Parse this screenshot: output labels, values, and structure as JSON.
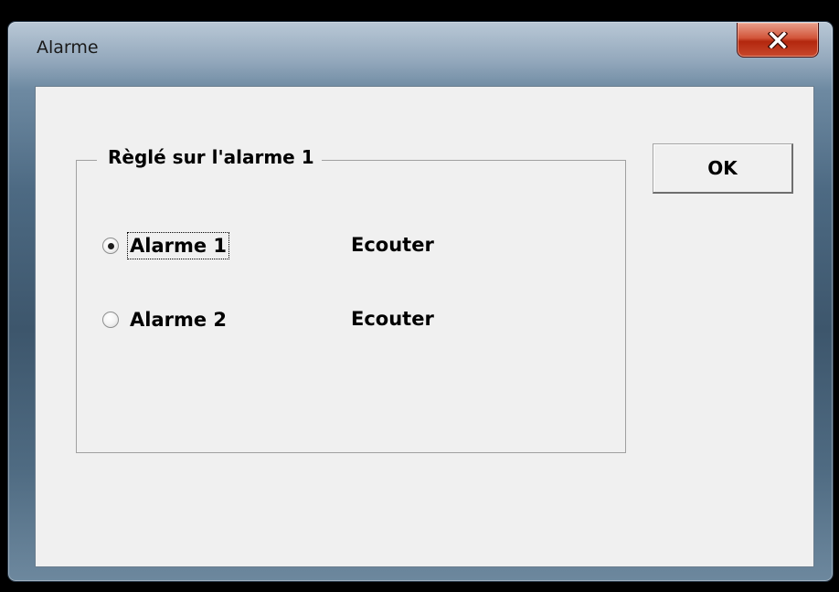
{
  "window": {
    "title": "Alarme"
  },
  "titlebar": {
    "close_icon": "close-icon"
  },
  "group": {
    "legend": "Règlé sur l'alarme 1",
    "options": [
      {
        "label": "Alarme 1",
        "selected": true,
        "focused": true,
        "listen_label": "Ecouter"
      },
      {
        "label": "Alarme 2",
        "selected": false,
        "focused": false,
        "listen_label": "Ecouter"
      }
    ]
  },
  "buttons": {
    "ok_label": "OK"
  },
  "colors": {
    "dialog_background": "#f0f0f0",
    "close_button_red": "#c8482c"
  }
}
